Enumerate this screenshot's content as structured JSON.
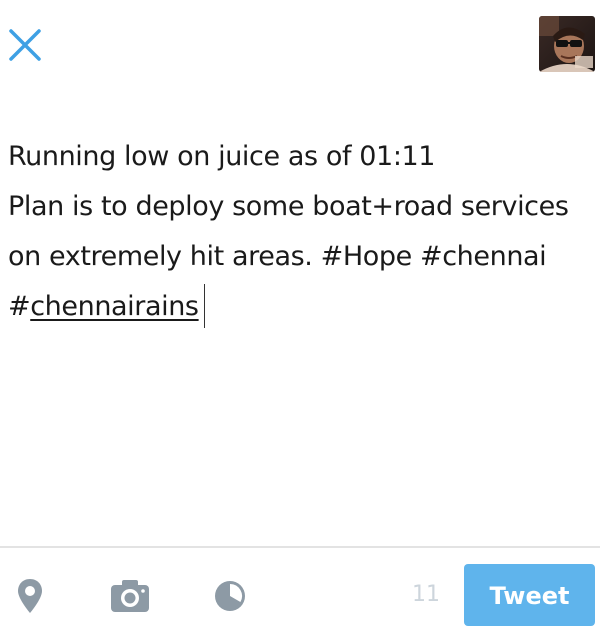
{
  "header": {
    "close_icon": "close-icon",
    "avatar_icon": "user-avatar"
  },
  "compose": {
    "lines": [
      "Running low on juice as of 01:11",
      "Plan is to deploy some boat+road services",
      "on extremely hit areas. #Hope #chennai"
    ],
    "last_line_prefix": "#",
    "last_line_underlined": "chennairains"
  },
  "toolbar": {
    "location_icon": "location-pin-icon",
    "camera_icon": "camera-icon",
    "poll_icon": "pie-chart-icon",
    "char_counter": "11",
    "tweet_label": "Tweet"
  },
  "colors": {
    "accent": "#5fb4ec",
    "close": "#3ea0e4",
    "icon_gray": "#8d9aa5",
    "counter": "#cdd5dc",
    "text": "#1a1a1a"
  }
}
